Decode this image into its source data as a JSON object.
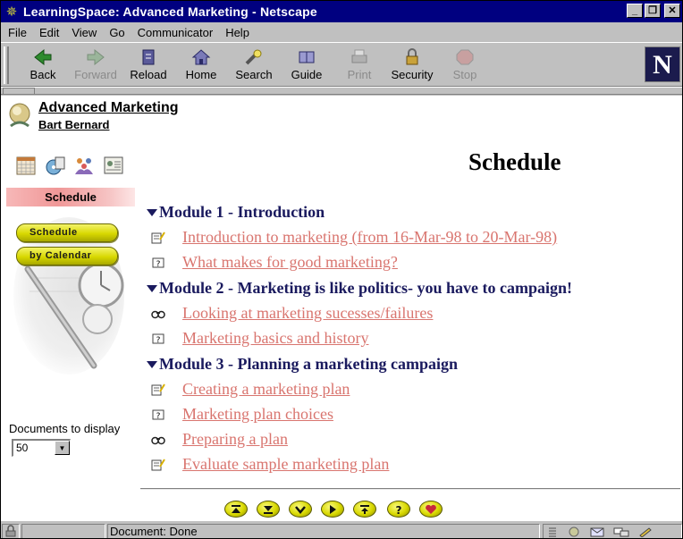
{
  "window": {
    "title": "LearningSpace: Advanced Marketing - Netscape",
    "controls": [
      "_",
      "❐",
      "✕"
    ]
  },
  "menu": [
    "File",
    "Edit",
    "View",
    "Go",
    "Communicator",
    "Help"
  ],
  "toolbar": {
    "buttons": [
      {
        "label": "Back",
        "icon": "back-arrow-icon",
        "enabled": true
      },
      {
        "label": "Forward",
        "icon": "forward-arrow-icon",
        "enabled": false
      },
      {
        "label": "Reload",
        "icon": "reload-icon",
        "enabled": true
      },
      {
        "label": "Home",
        "icon": "home-icon",
        "enabled": true
      },
      {
        "label": "Search",
        "icon": "search-flashlight-icon",
        "enabled": true
      },
      {
        "label": "Guide",
        "icon": "guide-icon",
        "enabled": true
      },
      {
        "label": "Print",
        "icon": "printer-icon",
        "enabled": false
      },
      {
        "label": "Security",
        "icon": "padlock-icon",
        "enabled": true
      },
      {
        "label": "Stop",
        "icon": "stop-icon",
        "enabled": false
      }
    ],
    "logo_letter": "N"
  },
  "course": {
    "title": "Advanced Marketing",
    "instructor": "Bart Bernard"
  },
  "sidebar": {
    "nav_icons": [
      "calendar-icon",
      "media-center-icon",
      "people-icon",
      "profile-card-icon"
    ],
    "section_label": "Schedule",
    "view_buttons": [
      "Schedule",
      "by Calendar"
    ],
    "docs_label": "Documents to display",
    "docs_value": "50"
  },
  "main": {
    "title": "Schedule",
    "modules": [
      {
        "title": "Module 1 - Introduction",
        "items": [
          {
            "icon": "reading-note-icon",
            "label": "Introduction to marketing (from 16-Mar-98 to 20-Mar-98)"
          },
          {
            "icon": "question-icon",
            "label": "What makes for good marketing?"
          }
        ]
      },
      {
        "title": "Module 2 - Marketing is like politics- you have to campaign!",
        "items": [
          {
            "icon": "binoculars-icon",
            "label": "Looking at marketing sucesses/failures"
          },
          {
            "icon": "question-icon",
            "label": "Marketing basics and history"
          }
        ]
      },
      {
        "title": "Module 3 - Planning a marketing campaign",
        "items": [
          {
            "icon": "reading-note-icon",
            "label": "Creating a marketing plan"
          },
          {
            "icon": "question-icon",
            "label": "Marketing plan choices"
          },
          {
            "icon": "binoculars-icon",
            "label": "Preparing a plan"
          },
          {
            "icon": "reading-note-icon",
            "label": "Evaluate sample marketing plan"
          }
        ]
      }
    ]
  },
  "bottom_nav": [
    {
      "icon": "go-to-top-icon",
      "glyph": "⏏"
    },
    {
      "icon": "go-to-bottom-icon",
      "glyph": "⏬"
    },
    {
      "icon": "next-down-icon",
      "glyph": "⌄"
    },
    {
      "icon": "forward-icon",
      "glyph": "▶"
    },
    {
      "icon": "up-level-icon",
      "glyph": "⤒"
    },
    {
      "icon": "help-icon",
      "glyph": "?"
    },
    {
      "icon": "favorite-heart-icon",
      "glyph": "♥"
    }
  ],
  "statusbar": {
    "status": "Document: Done"
  },
  "colors": {
    "link": "#d9756f",
    "module_heading": "#1a1a5e",
    "titlebar": "#000080"
  }
}
